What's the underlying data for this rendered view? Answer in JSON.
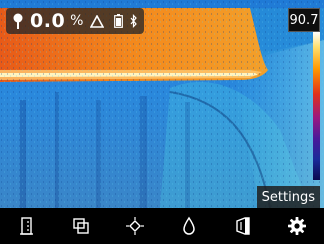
{
  "status": {
    "reading_value": "0.0",
    "reading_unit": "%",
    "probe_icon": "probe-icon",
    "delta_icon": "delta-icon",
    "battery_icon": "battery-icon",
    "bluetooth_icon": "bluetooth-icon"
  },
  "scale": {
    "max_value": "90.7"
  },
  "settings_label": "Settings",
  "toolbar": {
    "items": [
      {
        "icon": "door-frame-icon"
      },
      {
        "icon": "image-overlay-icon"
      },
      {
        "icon": "spot-target-icon"
      },
      {
        "icon": "droplet-icon"
      },
      {
        "icon": "wall-material-icon"
      },
      {
        "icon": "gear-icon"
      }
    ]
  },
  "colors": {
    "hot": "#f07a20",
    "hottest": "#fff2a0",
    "cool": "#2a80d8",
    "cold": "#0f3e8c",
    "overlay": "#282828",
    "toolbar": "#000000"
  }
}
